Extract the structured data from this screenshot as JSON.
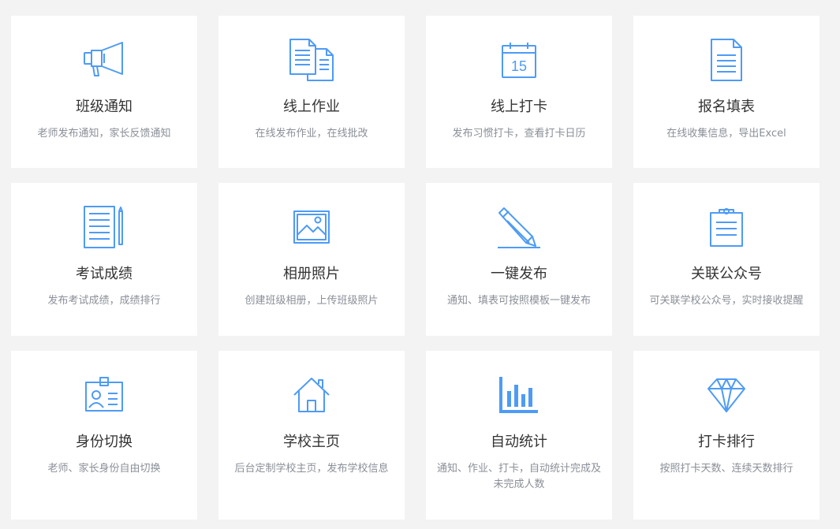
{
  "theme": {
    "background": "#f3f3f3",
    "card": "#ffffff",
    "accent": "#4e9bf5",
    "title_color": "#333333",
    "desc_color": "#8a8f97"
  },
  "features": [
    {
      "icon": "megaphone-icon",
      "title": "班级通知",
      "desc": "老师发布通知，家长反馈通知"
    },
    {
      "icon": "documents-icon",
      "title": "线上作业",
      "desc": "在线发布作业，在线批改"
    },
    {
      "icon": "calendar-icon",
      "title": "线上打卡",
      "desc": "发布习惯打卡，查看打卡日历",
      "calendar_day": "15"
    },
    {
      "icon": "form-document-icon",
      "title": "报名填表",
      "desc": "在线收集信息，导出Excel"
    },
    {
      "icon": "notebook-pencil-icon",
      "title": "考试成绩",
      "desc": "发布考试成绩，成绩排行"
    },
    {
      "icon": "photo-icon",
      "title": "相册照片",
      "desc": "创建班级相册，上传班级照片"
    },
    {
      "icon": "pencil-icon",
      "title": "一键发布",
      "desc": "通知、填表可按照模板一键发布"
    },
    {
      "icon": "clipboard-icon",
      "title": "关联公众号",
      "desc": "可关联学校公众号，实时接收提醒"
    },
    {
      "icon": "id-badge-icon",
      "title": "身份切换",
      "desc": "老师、家长身份自由切换"
    },
    {
      "icon": "house-icon",
      "title": "学校主页",
      "desc": "后台定制学校主页，发布学校信息"
    },
    {
      "icon": "bar-chart-icon",
      "title": "自动统计",
      "desc": "通知、作业、打卡，自动统计完成及未完成人数"
    },
    {
      "icon": "diamond-icon",
      "title": "打卡排行",
      "desc": "按照打卡天数、连续天数排行"
    }
  ]
}
